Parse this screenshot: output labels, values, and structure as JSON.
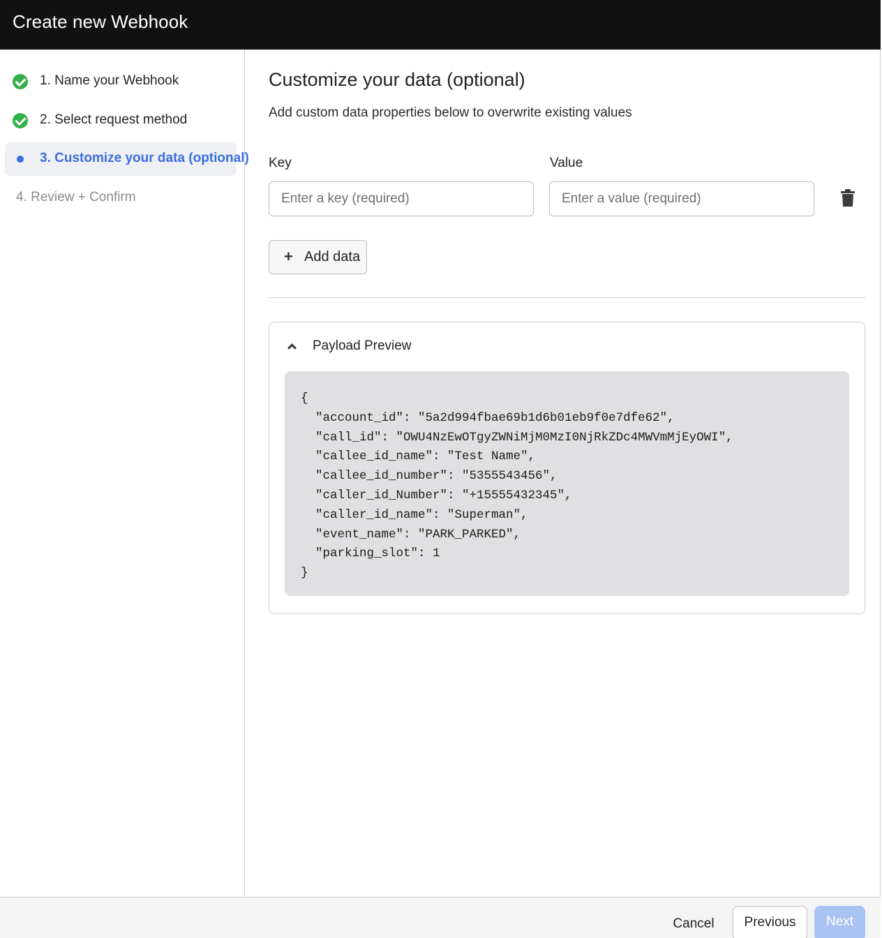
{
  "window": {
    "title": "Create new Webhook"
  },
  "steps": [
    {
      "label": "1. Name your Webhook",
      "state": "complete"
    },
    {
      "label": "2. Select request method",
      "state": "complete"
    },
    {
      "label": "3. Customize your data (optional)",
      "state": "active"
    },
    {
      "label": "4. Review + Confirm",
      "state": "pending"
    }
  ],
  "main": {
    "title": "Customize your data (optional)",
    "description": "Add custom data properties below to overwrite existing values",
    "key_label": "Key",
    "key_placeholder": "Enter a key (required)",
    "key_value": "",
    "value_label": "Value",
    "value_placeholder": "Enter a value (required)",
    "value_value": "",
    "add_button": {
      "icon": "plus-icon",
      "label": "Add data"
    },
    "delete_icon": "trash-icon"
  },
  "preview": {
    "label": "Payload Preview",
    "toggle_icon": "chevron-up-icon",
    "lines": [
      "{",
      "  \"account_id\": \"5a2d994fbae69b1d6b01eb9f0e7dfe62\",",
      "  \"call_id\": \"OWU4NzEwOTgyZWNiMjM0MzI0NjRkZDc4MWVmMjEyOWI\",",
      "  \"callee_id_name\": \"Test Name\",",
      "  \"callee_id_number\": \"5355543456\",",
      "  \"caller_id_Number\": \"+15555432345\",",
      "  \"caller_id_name\": \"Superman\",",
      "  \"event_name\": \"PARK_PARKED\",",
      "  \"parking_slot\": 1",
      "}"
    ]
  },
  "footer": {
    "cancel": "Cancel",
    "previous": "Previous",
    "next": "Next",
    "next_disabled": true
  },
  "colors": {
    "header_bg": "#111111",
    "accent": "#3a6fe0",
    "complete": "#34b04a",
    "next_disabled_bg": "#a9c3f3"
  }
}
